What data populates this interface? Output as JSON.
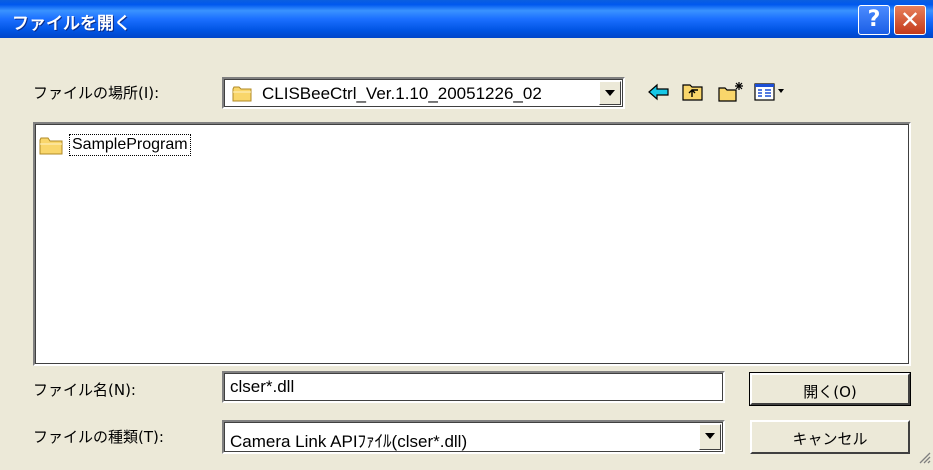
{
  "window": {
    "title": "ファイルを開く"
  },
  "look_in": {
    "label": "ファイルの場所(I):",
    "value": "CLISBeeCtrl_Ver.1.10_20051226_02"
  },
  "toolbar": {
    "back_icon": "back-arrow-icon",
    "up_icon": "up-folder-icon",
    "new_folder_icon": "new-folder-icon",
    "view_menu_icon": "view-menu-icon"
  },
  "files": [
    {
      "name": "SampleProgram",
      "icon": "folder-icon"
    }
  ],
  "filename": {
    "label": "ファイル名(N):",
    "value": "clser*.dll"
  },
  "filetype": {
    "label": "ファイルの種類(T):",
    "value": "Camera Link APIﾌｧｲﾙ(clser*.dll)"
  },
  "buttons": {
    "open": "開く(O)",
    "cancel": "キャンセル"
  },
  "colors": {
    "titlebar": "#0054e3",
    "dialog_bg": "#ece9d8",
    "close_button": "#c33a1b"
  }
}
